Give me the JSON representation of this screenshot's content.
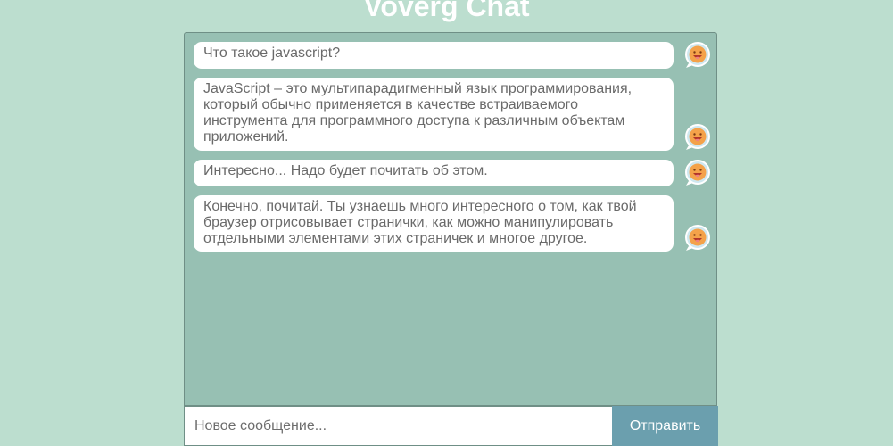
{
  "header": {
    "title": "Voverg Chat"
  },
  "messages": [
    {
      "text": "Что такое javascript?",
      "avatar_icon": "smiley-face-icon"
    },
    {
      "text": "JavaScript – это мультипарадигменный язык программирования, который обычно применяется в качестве встраиваемого инструмента для программного доступа к различным объектам приложений.",
      "avatar_icon": "smiley-face-icon"
    },
    {
      "text": "Интересно... Надо будет почитать об этом.",
      "avatar_icon": "smiley-face-icon"
    },
    {
      "text": "Конечно, почитай. Ты узнаешь много интересного о том, как твой браузер отрисовывает странички, как можно манипулировать отдельными элементами этих страничек и многое другое.",
      "avatar_icon": "smiley-face-icon"
    }
  ],
  "composer": {
    "placeholder": "Новое сообщение...",
    "value": "",
    "send_label": "Отправить"
  },
  "colors": {
    "background": "#bcdecf",
    "chat_panel": "#97c0b3",
    "send_button": "#6b9fae",
    "bubble": "#ffffff"
  }
}
